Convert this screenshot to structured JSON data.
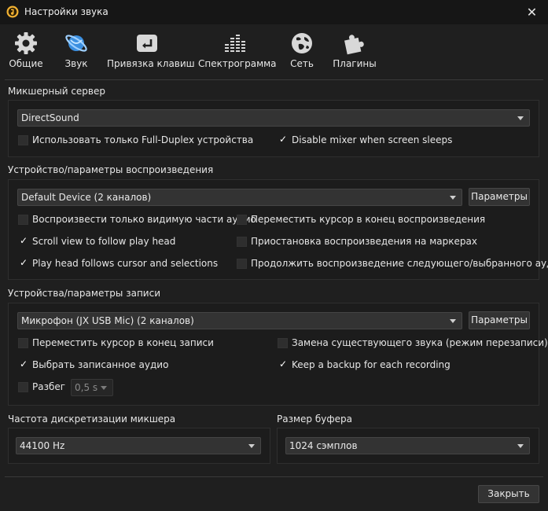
{
  "window": {
    "title": "Настройки звука"
  },
  "toolbar": {
    "items": [
      {
        "label": "Общие",
        "icon": "gear-icon"
      },
      {
        "label": "Звук",
        "icon": "sound-orbit-icon"
      },
      {
        "label": "Привязка клавиш",
        "icon": "keyboard-enter-icon"
      },
      {
        "label": "Спектрограмма",
        "icon": "spectrum-bars-icon"
      },
      {
        "label": "Сеть",
        "icon": "network-globe-icon"
      },
      {
        "label": "Плагины",
        "icon": "puzzle-icon"
      }
    ],
    "active_index": 1,
    "accent_color": "#3b8fe0"
  },
  "mixer": {
    "title": "Микшерный сервер",
    "server": "DirectSound",
    "full_duplex": {
      "label": "Использовать только Full-Duplex устройства",
      "checked": false
    },
    "disable_sleep": {
      "label": "Disable mixer when screen sleeps",
      "checked": true
    }
  },
  "playback": {
    "title": "Устройство/параметры воспроизведения",
    "device": "Default Device (2 каналов)",
    "params_button": "Параметры",
    "options": [
      {
        "label": "Воспроизвести только видимую части аудио",
        "checked": false
      },
      {
        "label": "Переместить курсор в конец воспроизведения",
        "checked": false
      },
      {
        "label": "Scroll view to follow play head",
        "checked": true
      },
      {
        "label": "Приостановка воспроизведения на маркерах",
        "checked": false
      },
      {
        "label": "Play head follows cursor and selections",
        "checked": true
      },
      {
        "label": "Продолжить воспроизведение следующего/выбранного аудио",
        "checked": false
      }
    ]
  },
  "recording": {
    "title": "Устройства/параметры записи",
    "device": "Микрофон (JX USB Mic) (2 каналов)",
    "params_button": "Параметры",
    "options": [
      {
        "label": "Переместить курсор в конец записи",
        "checked": false
      },
      {
        "label": "Замена существующего звука (режим перезаписи)",
        "checked": false
      },
      {
        "label": "Выбрать записанное аудио",
        "checked": true
      },
      {
        "label": "Keep a backup for each recording",
        "checked": true
      }
    ],
    "split": {
      "label": "Разбег",
      "checked": false,
      "value": "0,5 s"
    }
  },
  "sample_rate": {
    "title": "Частота дискретизации микшера",
    "value": "44100 Hz"
  },
  "buffer": {
    "title": "Размер буфера",
    "value": "1024 сэмплов"
  },
  "footer": {
    "close_button": "Закрыть"
  }
}
